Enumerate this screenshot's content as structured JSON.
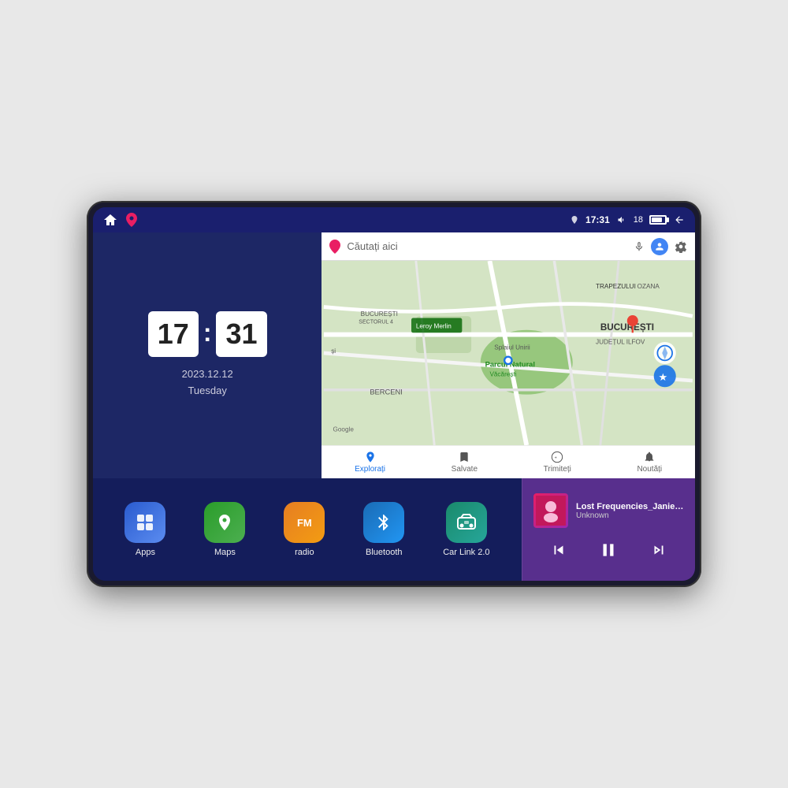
{
  "device": {
    "status_bar": {
      "time": "17:31",
      "battery_level": "18",
      "signal": "▽"
    },
    "clock": {
      "hour": "17",
      "minute": "31",
      "date": "2023.12.12",
      "day": "Tuesday"
    },
    "map": {
      "search_placeholder": "Căutați aici",
      "location_label": "Parcul Natural Văcărești",
      "city_label": "BUCUREȘTI",
      "region_label": "JUDEȚUL ILFOV",
      "nav_items": [
        {
          "label": "Explorați",
          "active": true
        },
        {
          "label": "Salvate",
          "active": false
        },
        {
          "label": "Trimiteți",
          "active": false
        },
        {
          "label": "Noutăți",
          "active": false
        }
      ]
    },
    "apps": [
      {
        "id": "apps",
        "label": "Apps",
        "icon_class": "icon-apps"
      },
      {
        "id": "maps",
        "label": "Maps",
        "icon_class": "icon-maps"
      },
      {
        "id": "radio",
        "label": "radio",
        "icon_class": "icon-radio"
      },
      {
        "id": "bluetooth",
        "label": "Bluetooth",
        "icon_class": "icon-bluetooth"
      },
      {
        "id": "carlink",
        "label": "Car Link 2.0",
        "icon_class": "icon-carlink"
      }
    ],
    "music": {
      "title": "Lost Frequencies_Janieck Devy-...",
      "artist": "Unknown",
      "controls": {
        "prev": "⏮",
        "play": "⏸",
        "next": "⏭"
      }
    }
  }
}
